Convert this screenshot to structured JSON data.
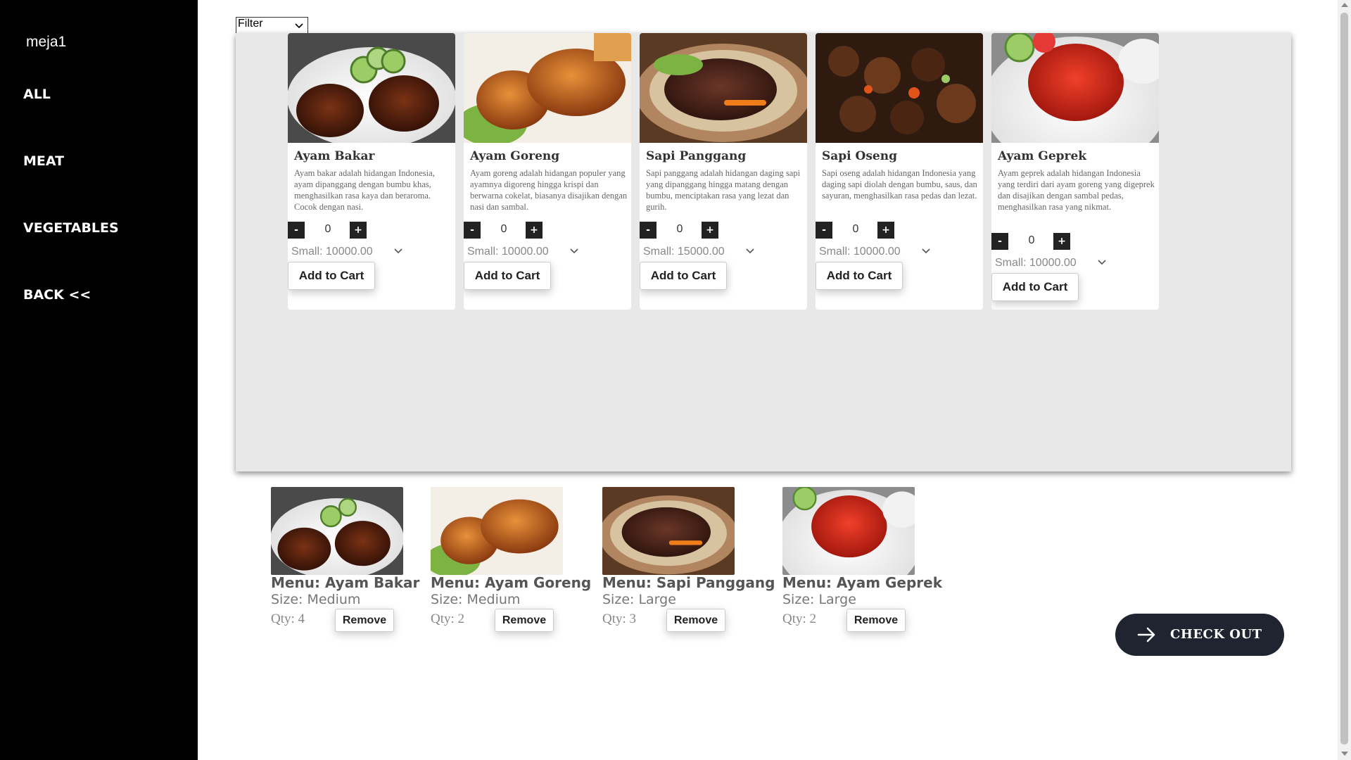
{
  "sidebar": {
    "table_name": "meja1",
    "items": [
      {
        "label": "ALL"
      },
      {
        "label": "MEAT"
      },
      {
        "label": "VEGETABLES"
      },
      {
        "label": "BACK <<"
      }
    ]
  },
  "filter": {
    "selected": "Filter"
  },
  "menu_cards": [
    {
      "title": "Ayam Bakar",
      "description": "Ayam bakar adalah hidangan Indonesia, ayam dipanggang dengan bumbu khas, menghasilkan rasa kaya dan beraroma. Cocok dengan nasi.",
      "qty": "0",
      "size": "Small: 10000.00",
      "add_label": "Add to Cart",
      "minus": "-",
      "plus": "+"
    },
    {
      "title": "Ayam Goreng",
      "description": "Ayam goreng adalah hidangan populer yang ayamnya digoreng hingga krispi dan berwarna cokelat, biasanya disajikan dengan nasi dan sambal.",
      "qty": "0",
      "size": "Small: 10000.00",
      "add_label": "Add to Cart",
      "minus": "-",
      "plus": "+"
    },
    {
      "title": "Sapi Panggang",
      "description": "Sapi panggang adalah hidangan daging sapi yang dipanggang hingga matang dengan bumbu, menciptakan rasa yang lezat dan gurih.",
      "qty": "0",
      "size": "Small: 15000.00",
      "add_label": "Add to Cart",
      "minus": "-",
      "plus": "+"
    },
    {
      "title": "Sapi Oseng",
      "description": "Sapi oseng adalah hidangan Indonesia yang daging sapi diolah dengan bumbu, saus, dan sayuran, menghasilkan rasa pedas dan lezat.",
      "qty": "0",
      "size": "Small: 10000.00",
      "add_label": "Add to Cart",
      "minus": "-",
      "plus": "+"
    },
    {
      "title": "Ayam Geprek",
      "description": "Ayam geprek adalah hidangan Indonesia yang terdiri dari ayam goreng yang digeprek dan disajikan dengan sambal pedas, menghasilkan rasa yang nikmat.",
      "qty": "0",
      "size": "Small: 10000.00",
      "add_label": "Add to Cart",
      "minus": "-",
      "plus": "+"
    }
  ],
  "cart": [
    {
      "menu": "Menu: Ayam Bakar",
      "size": "Size: Medium",
      "qty": "Qty: 4",
      "remove_label": "Remove"
    },
    {
      "menu": "Menu: Ayam Goreng",
      "size": "Size: Medium",
      "qty": "Qty: 2",
      "remove_label": "Remove"
    },
    {
      "menu": "Menu: Sapi Panggang",
      "size": "Size: Large",
      "qty": "Qty: 3",
      "remove_label": "Remove"
    },
    {
      "menu": "Menu: Ayam Geprek",
      "size": "Size: Large",
      "qty": "Qty: 2",
      "remove_label": "Remove"
    }
  ],
  "checkout": {
    "label": "CHECK OUT",
    "icon": "arrow-right-icon",
    "color": "#1f2430"
  },
  "colors": {
    "sidebar": "#000000",
    "panel": "#e8e8e8",
    "qty_button": "#222222"
  }
}
